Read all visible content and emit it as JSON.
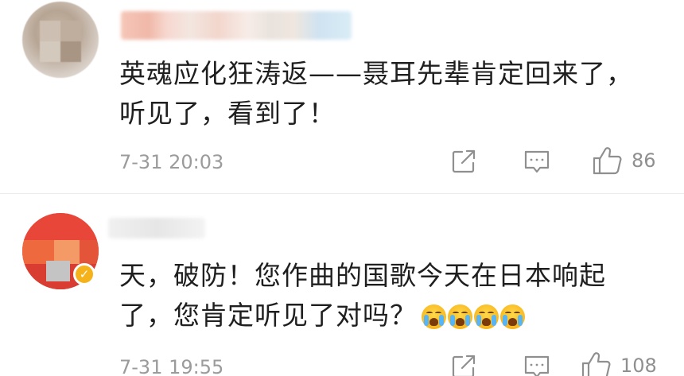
{
  "comments": [
    {
      "text": "英魂应化狂涛返——聂耳先辈肯定回来了，\n听见了，看到了！",
      "time": "7-31 20:03",
      "likes": "86",
      "verified": false
    },
    {
      "text": "天，破防！您作曲的国歌今天在日本响起\n了，您肯定听见了对吗？",
      "emoji": [
        "crying-face",
        "crying-face",
        "crying-face",
        "crying-face"
      ],
      "time": "7-31 19:55",
      "likes": "108",
      "verified": true
    }
  ],
  "icons": {
    "share": "share-icon",
    "reply": "comment-icon",
    "like": "thumbs-up-icon",
    "verified": "verified-badge-icon"
  },
  "colors": {
    "text": "#1f1f1f",
    "meta": "#9b9b9b",
    "verified": "#f6b21b",
    "avatar2": "#e84a3a"
  }
}
